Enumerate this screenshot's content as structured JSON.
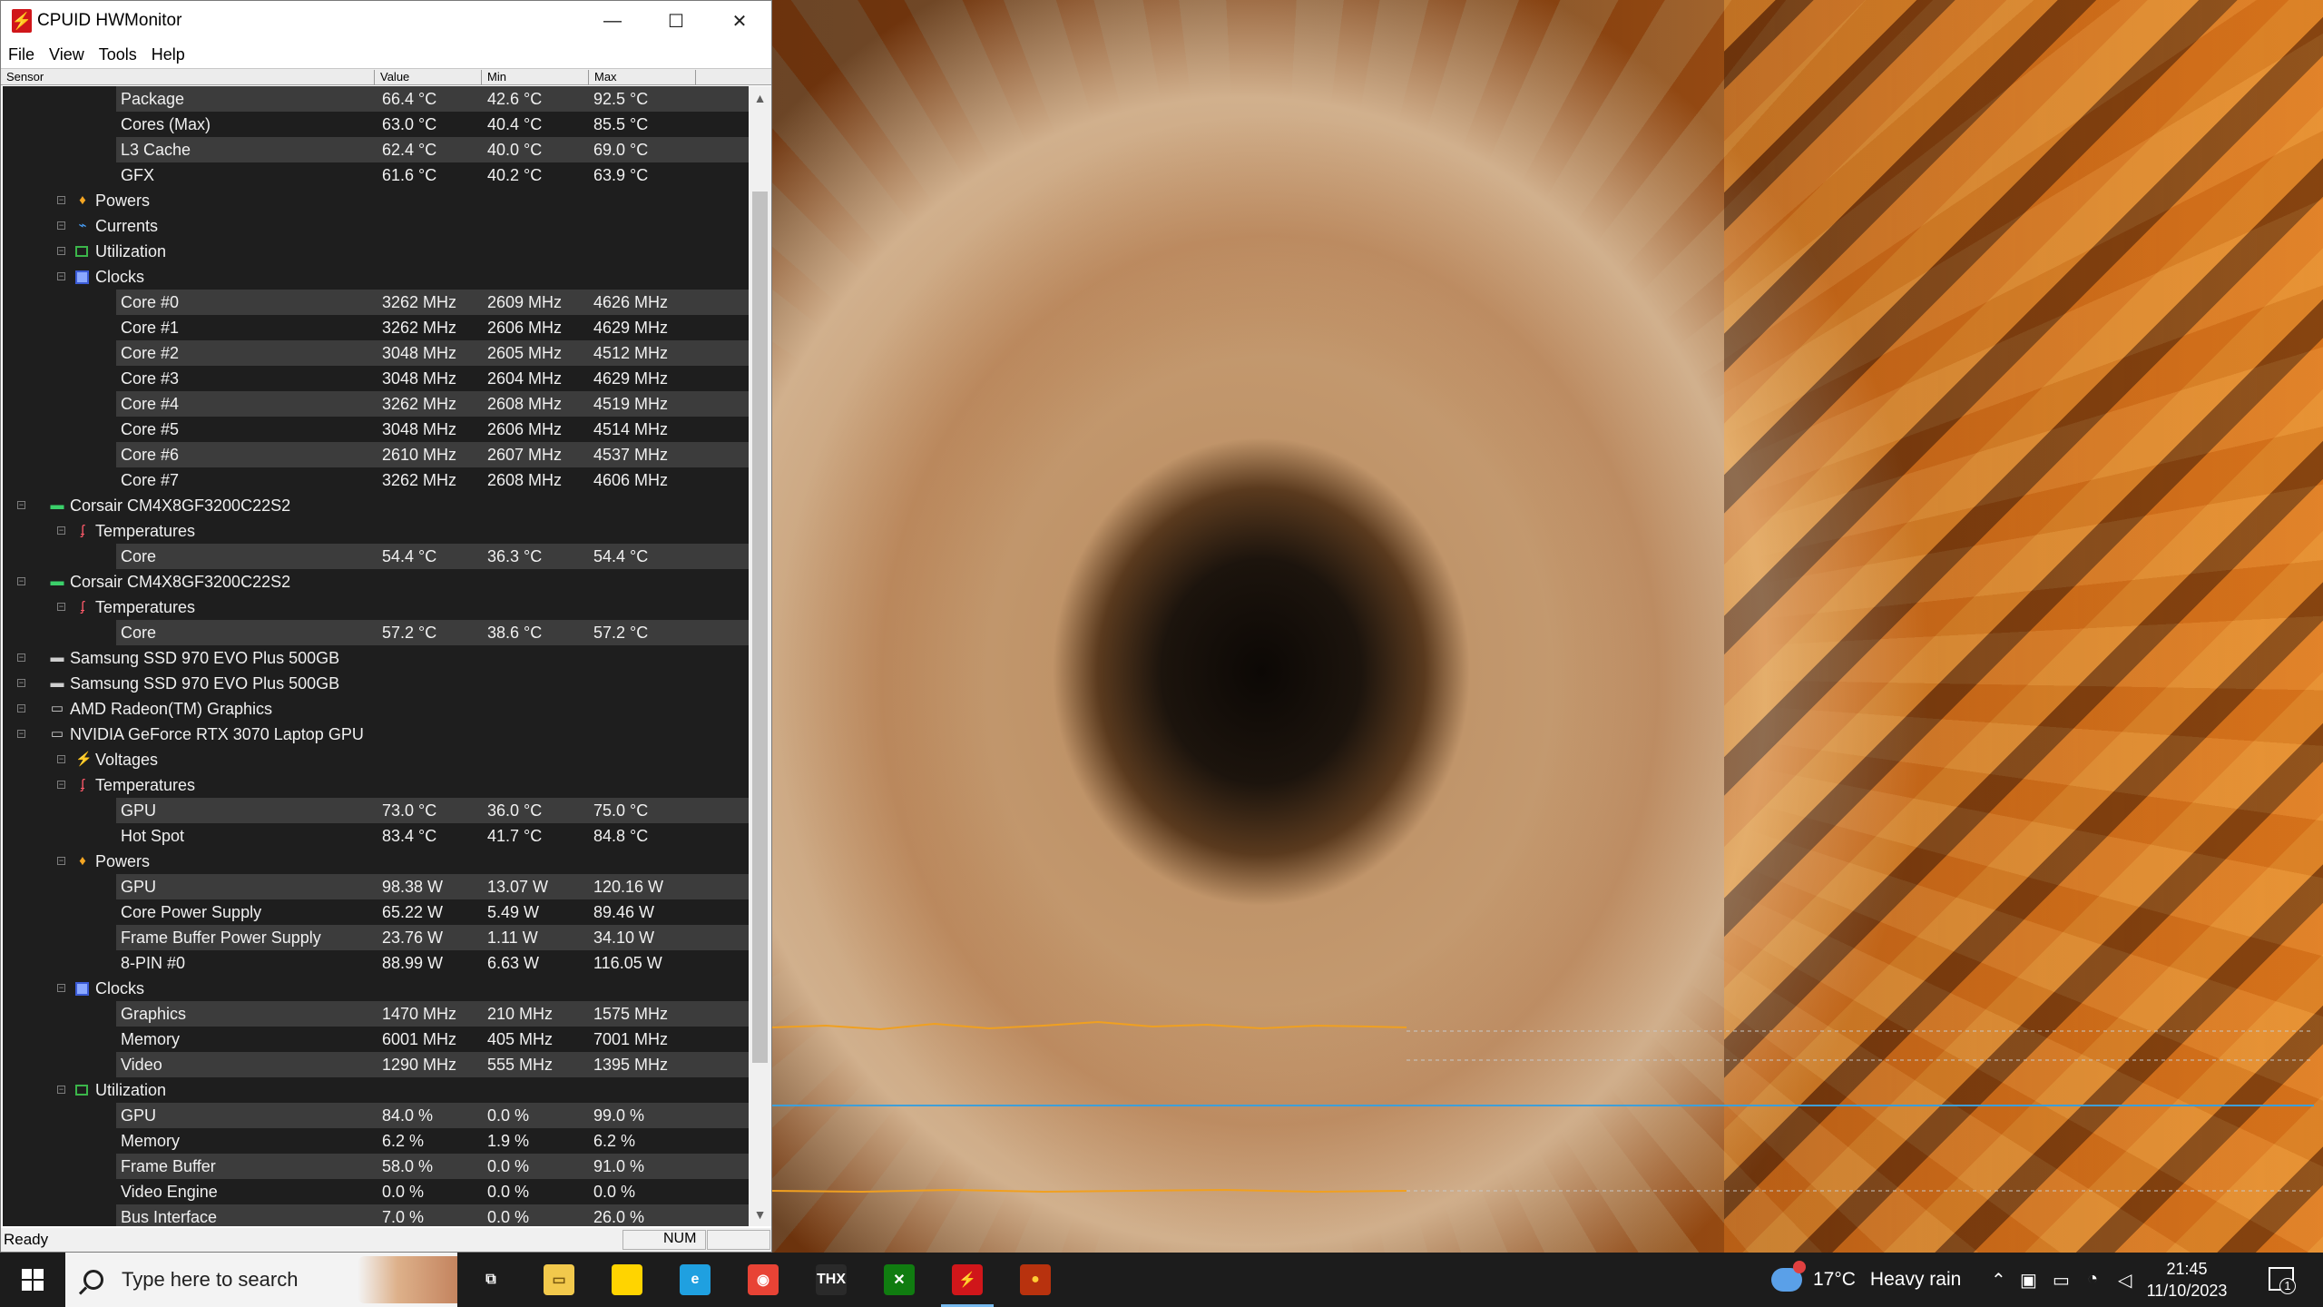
{
  "window": {
    "title": "CPUID HWMonitor",
    "controls": {
      "minimize": "—",
      "maximize": "☐",
      "close": "✕"
    }
  },
  "menu": [
    "File",
    "View",
    "Tools",
    "Help"
  ],
  "columns": {
    "sensor": "Sensor",
    "value": "Value",
    "min": "Min",
    "max": "Max"
  },
  "rows": [
    {
      "name": "Package",
      "value": "66.4 °C",
      "min": "42.6 °C",
      "max": "92.5 °C",
      "level": 3,
      "shade": true
    },
    {
      "name": "Cores (Max)",
      "value": "63.0 °C",
      "min": "40.4 °C",
      "max": "85.5 °C",
      "level": 3,
      "shade": false
    },
    {
      "name": "L3 Cache",
      "value": "62.4 °C",
      "min": "40.0 °C",
      "max": "69.0 °C",
      "level": 3,
      "shade": true
    },
    {
      "name": "GFX",
      "value": "61.6 °C",
      "min": "40.2 °C",
      "max": "63.9 °C",
      "level": 3,
      "shade": false
    },
    {
      "name": "Powers",
      "level": 2,
      "icon": "power-icon",
      "glyph": "♦"
    },
    {
      "name": "Currents",
      "level": 2,
      "icon": "current-icon",
      "glyph": "⌁"
    },
    {
      "name": "Utilization",
      "level": 2,
      "icon": "utilization-icon",
      "glyph": ""
    },
    {
      "name": "Clocks",
      "level": 2,
      "icon": "clock-icon",
      "glyph": ""
    },
    {
      "name": "Core #0",
      "value": "3262 MHz",
      "min": "2609 MHz",
      "max": "4626 MHz",
      "level": 3,
      "shade": true
    },
    {
      "name": "Core #1",
      "value": "3262 MHz",
      "min": "2606 MHz",
      "max": "4629 MHz",
      "level": 3,
      "shade": false
    },
    {
      "name": "Core #2",
      "value": "3048 MHz",
      "min": "2605 MHz",
      "max": "4512 MHz",
      "level": 3,
      "shade": true
    },
    {
      "name": "Core #3",
      "value": "3048 MHz",
      "min": "2604 MHz",
      "max": "4629 MHz",
      "level": 3,
      "shade": false
    },
    {
      "name": "Core #4",
      "value": "3262 MHz",
      "min": "2608 MHz",
      "max": "4519 MHz",
      "level": 3,
      "shade": true
    },
    {
      "name": "Core #5",
      "value": "3048 MHz",
      "min": "2606 MHz",
      "max": "4514 MHz",
      "level": 3,
      "shade": false
    },
    {
      "name": "Core #6",
      "value": "2610 MHz",
      "min": "2607 MHz",
      "max": "4537 MHz",
      "level": 3,
      "shade": true
    },
    {
      "name": "Core #7",
      "value": "3262 MHz",
      "min": "2608 MHz",
      "max": "4606 MHz",
      "level": 3,
      "shade": false
    },
    {
      "name": "Corsair CM4X8GF3200C22S2",
      "level": 1,
      "icon": "memory-icon",
      "glyph": "▬"
    },
    {
      "name": "Temperatures",
      "level": 2,
      "icon": "temperature-icon",
      "glyph": "ʄ"
    },
    {
      "name": "Core",
      "value": "54.4 °C",
      "min": "36.3 °C",
      "max": "54.4 °C",
      "level": 3,
      "shade": true
    },
    {
      "name": "Corsair CM4X8GF3200C22S2",
      "level": 1,
      "icon": "memory-icon",
      "glyph": "▬"
    },
    {
      "name": "Temperatures",
      "level": 2,
      "icon": "temperature-icon",
      "glyph": "ʄ"
    },
    {
      "name": "Core",
      "value": "57.2 °C",
      "min": "38.6 °C",
      "max": "57.2 °C",
      "level": 3,
      "shade": true
    },
    {
      "name": "Samsung SSD 970 EVO Plus 500GB",
      "level": 1,
      "icon": "ssd-icon",
      "glyph": "▬"
    },
    {
      "name": "Samsung SSD 970 EVO Plus 500GB",
      "level": 1,
      "icon": "ssd-icon",
      "glyph": "▬"
    },
    {
      "name": "AMD Radeon(TM) Graphics",
      "level": 1,
      "icon": "gpu-icon",
      "glyph": "▭"
    },
    {
      "name": "NVIDIA GeForce RTX 3070 Laptop GPU",
      "level": 1,
      "icon": "gpu-icon",
      "glyph": "▭"
    },
    {
      "name": "Voltages",
      "level": 2,
      "icon": "voltage-icon",
      "glyph": "⚡"
    },
    {
      "name": "Temperatures",
      "level": 2,
      "icon": "temperature-icon",
      "glyph": "ʄ"
    },
    {
      "name": "GPU",
      "value": "73.0 °C",
      "min": "36.0 °C",
      "max": "75.0 °C",
      "level": 3,
      "shade": true
    },
    {
      "name": "Hot Spot",
      "value": "83.4 °C",
      "min": "41.7 °C",
      "max": "84.8 °C",
      "level": 3,
      "shade": false
    },
    {
      "name": "Powers",
      "level": 2,
      "icon": "power-icon",
      "glyph": "♦"
    },
    {
      "name": "GPU",
      "value": "98.38 W",
      "min": "13.07 W",
      "max": "120.16 W",
      "level": 3,
      "shade": true
    },
    {
      "name": "Core Power Supply",
      "value": "65.22 W",
      "min": "5.49 W",
      "max": "89.46 W",
      "level": 3,
      "shade": false
    },
    {
      "name": "Frame Buffer Power Supply",
      "value": "23.76 W",
      "min": "1.11 W",
      "max": "34.10 W",
      "level": 3,
      "shade": true
    },
    {
      "name": "8-PIN #0",
      "value": "88.99 W",
      "min": "6.63 W",
      "max": "116.05 W",
      "level": 3,
      "shade": false
    },
    {
      "name": "Clocks",
      "level": 2,
      "icon": "clock-icon",
      "glyph": ""
    },
    {
      "name": "Graphics",
      "value": "1470 MHz",
      "min": "210 MHz",
      "max": "1575 MHz",
      "level": 3,
      "shade": true
    },
    {
      "name": "Memory",
      "value": "6001 MHz",
      "min": "405 MHz",
      "max": "7001 MHz",
      "level": 3,
      "shade": false
    },
    {
      "name": "Video",
      "value": "1290 MHz",
      "min": "555 MHz",
      "max": "1395 MHz",
      "level": 3,
      "shade": true
    },
    {
      "name": "Utilization",
      "level": 2,
      "icon": "utilization-icon",
      "glyph": ""
    },
    {
      "name": "GPU",
      "value": "84.0 %",
      "min": "0.0 %",
      "max": "99.0 %",
      "level": 3,
      "shade": true
    },
    {
      "name": "Memory",
      "value": "6.2 %",
      "min": "1.9 %",
      "max": "6.2 %",
      "level": 3,
      "shade": false
    },
    {
      "name": "Frame Buffer",
      "value": "58.0 %",
      "min": "0.0 %",
      "max": "91.0 %",
      "level": 3,
      "shade": true
    },
    {
      "name": "Video Engine",
      "value": "0.0 %",
      "min": "0.0 %",
      "max": "0.0 %",
      "level": 3,
      "shade": false
    },
    {
      "name": "Bus Interface",
      "value": "7.0 %",
      "min": "0.0 %",
      "max": "26.0 %",
      "level": 3,
      "shade": true
    }
  ],
  "status": {
    "text": "Ready",
    "num": "NUM"
  },
  "taskbar": {
    "search_placeholder": "Type here to search",
    "apps": [
      {
        "name": "task-view-icon",
        "glyph": "⧉",
        "bg": "transparent",
        "color": "#ffffff"
      },
      {
        "name": "file-explorer-icon",
        "glyph": "▭",
        "bg": "#f2c94c",
        "color": "#7a5a10"
      },
      {
        "name": "sticky-notes-icon",
        "glyph": "",
        "bg": "#ffd400",
        "color": "#000000"
      },
      {
        "name": "edge-icon",
        "glyph": "e",
        "bg": "#1fa0e0",
        "color": "#ffffff"
      },
      {
        "name": "chrome-icon",
        "glyph": "◉",
        "bg": "#e84335",
        "color": "#ffffff"
      },
      {
        "name": "thx-icon",
        "glyph": "THX",
        "bg": "#2a2a2a",
        "color": "#ffffff"
      },
      {
        "name": "xbox-icon",
        "glyph": "✕",
        "bg": "#107c10",
        "color": "#ffffff"
      },
      {
        "name": "hwmonitor-icon",
        "glyph": "⚡",
        "bg": "#d0161a",
        "color": "#ffffff"
      },
      {
        "name": "furmark-icon",
        "glyph": "●",
        "bg": "#b8320e",
        "color": "#ffcc33"
      }
    ],
    "weather_temp": "17°C",
    "weather_text": "Heavy rain",
    "time": "21:45",
    "date": "11/10/2023",
    "notification_count": "1"
  }
}
